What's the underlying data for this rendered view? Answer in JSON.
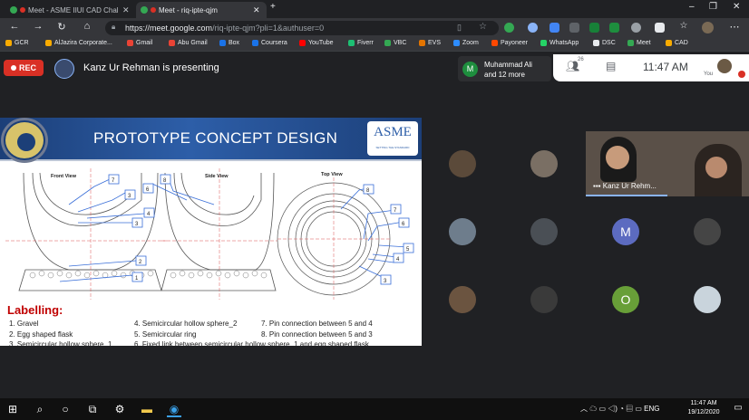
{
  "browser": {
    "tabs": [
      {
        "title": "Meet - ASME IIUI CAD Chal",
        "active": false
      },
      {
        "title": "Meet - riq-ipte-qjm",
        "active": true
      }
    ],
    "new_tab": "+",
    "window_controls": {
      "minimize": "–",
      "restore": "❐",
      "close": "✕"
    },
    "url_domain": "https://meet.google.com",
    "url_path": "/riq-ipte-qjm?pli=1&authuser=0",
    "bookmarks": [
      "GCR",
      "AlJazira Corporate...",
      "Gmail",
      "Abu Gmail",
      "Box",
      "Coursera",
      "YouTube",
      "Fiverr",
      "VBC",
      "EVS",
      "Zoom",
      "Payoneer",
      "WhatsApp",
      "DSC",
      "Meet",
      "CAD"
    ]
  },
  "meet": {
    "rec_label": "REC",
    "presenting_text": "Kanz Ur Rehman is presenting",
    "notification": {
      "initial": "M",
      "line1": "Muhammad Ali",
      "line2": "and 12 more"
    },
    "participant_count": "26",
    "time": "11:47 AM",
    "you_label": "You",
    "video_tile_name": "Kanz Ur Rehm...",
    "participant_initials": [
      "M",
      "O"
    ]
  },
  "slide": {
    "title": "PROTOTYPE CONCEPT DESIGN",
    "logo_text": "ASME",
    "logo_subtext": "SETTING THE STANDARD",
    "views": [
      "Front View",
      "Side View",
      "Top View"
    ],
    "callouts": [
      "7",
      "8",
      "6",
      "3",
      "4",
      "3",
      "2",
      "1",
      "8",
      "7",
      "6",
      "5",
      "4",
      "3"
    ],
    "labelling_title": "Labelling:",
    "labels": [
      "1.  Gravel",
      "2.  Egg shaped flask",
      "3.  Semicircular hollow sphere_1",
      "4.  Semicircular hollow sphere_2",
      "5.  Semicircular ring",
      "6.  Fixed link between semicircular hollow sphere_1 and egg shaped flask",
      "7.  Pin connection between 5 and 4",
      "8.  Pin connection between 5 and 3"
    ]
  },
  "taskbar": {
    "tray_text": "ENG",
    "time": "11:47 AM",
    "date": "19/12/2020"
  },
  "colors": {
    "rec": "#d93025",
    "slide_header": "#1c3f78",
    "labelling": "#c00000",
    "callout_lines": "#3a6fd8",
    "meet_bg": "#202124"
  }
}
